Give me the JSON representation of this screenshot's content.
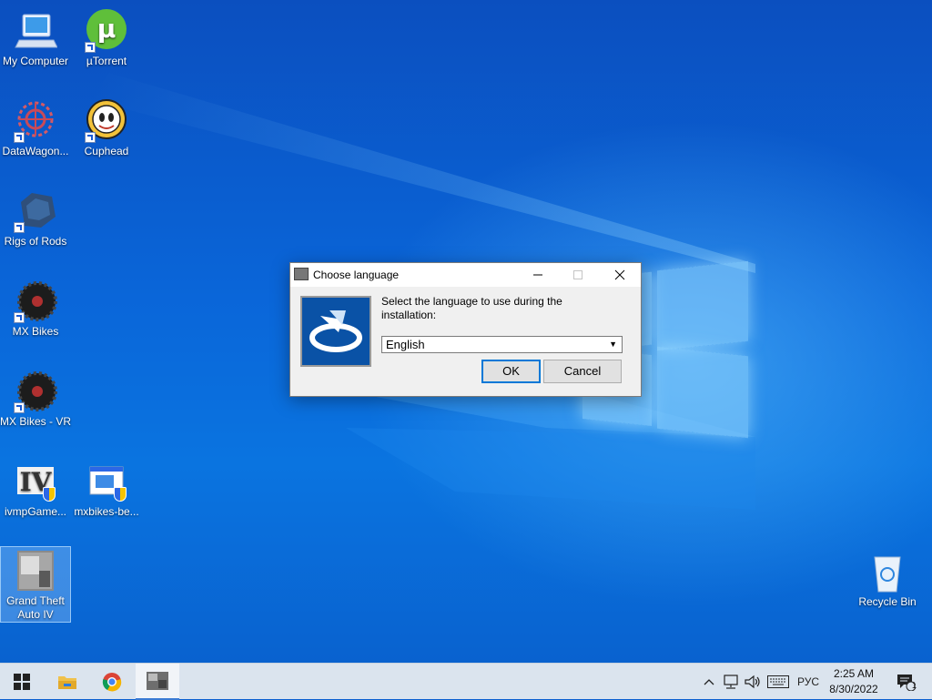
{
  "desktop": {
    "icons": [
      {
        "label": "My Computer"
      },
      {
        "label": "µTorrent"
      },
      {
        "label": "DataWagon..."
      },
      {
        "label": "Cuphead"
      },
      {
        "label": "Rigs of Rods"
      },
      {
        "label": "MX Bikes"
      },
      {
        "label": "MX Bikes - VR"
      },
      {
        "label": "ivmpGame..."
      },
      {
        "label": "mxbikes-be..."
      },
      {
        "label": "Grand Theft Auto IV"
      },
      {
        "label": "Recycle Bin"
      }
    ]
  },
  "dialog": {
    "title": "Choose language",
    "prompt": "Select the language to use during the installation:",
    "language_selected": "English",
    "ok_label": "OK",
    "cancel_label": "Cancel"
  },
  "taskbar": {
    "pinned": [
      "windows-start-icon",
      "file-explorer-icon",
      "chrome-icon",
      "gta-iv-setup-icon"
    ],
    "tray": {
      "language": "РУС",
      "time": "2:25 AM",
      "date": "8/30/2022",
      "notification_count": "1"
    }
  },
  "colors": {
    "desktop_blue": "#0a66d9",
    "taskbar": "#dbe4ee",
    "dialog_bg": "#f0f0f0",
    "setup_logo_blue": "#0a52a6",
    "default_button_border": "#0078d7"
  }
}
